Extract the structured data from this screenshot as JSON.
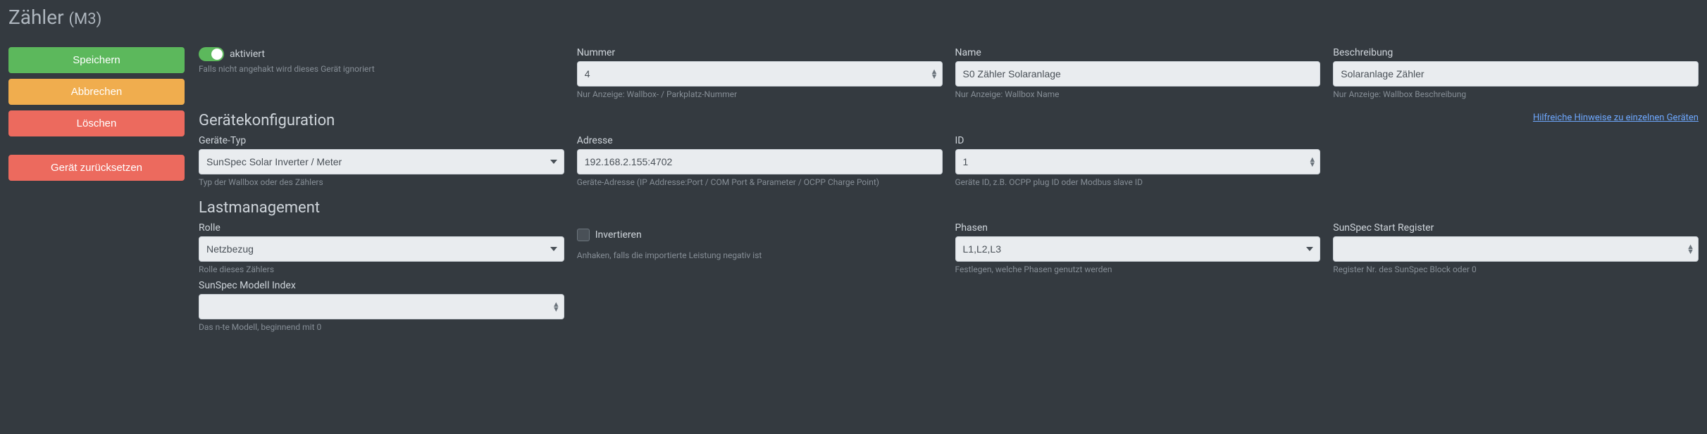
{
  "header": {
    "title_main": "Zähler",
    "title_sub": "(M3)"
  },
  "sidebar": {
    "save": "Speichern",
    "cancel": "Abbrechen",
    "delete": "Löschen",
    "reset": "Gerät zurücksetzen"
  },
  "activated": {
    "label": "aktiviert",
    "help": "Falls nicht angehakt wird dieses Gerät ignoriert",
    "checked": true
  },
  "nummer": {
    "label": "Nummer",
    "value": "4",
    "help": "Nur Anzeige: Wallbox- / Parkplatz-Nummer"
  },
  "name": {
    "label": "Name",
    "value": "S0 Zähler Solaranlage",
    "help": "Nur Anzeige: Wallbox Name"
  },
  "beschreibung": {
    "label": "Beschreibung",
    "value": "Solaranlage Zähler",
    "help": "Nur Anzeige: Wallbox Beschreibung"
  },
  "sections": {
    "config": "Gerätekonfiguration",
    "config_link": "Hilfreiche Hinweise zu einzelnen Geräten",
    "load": "Lastmanagement"
  },
  "geraete_typ": {
    "label": "Geräte-Typ",
    "value": "SunSpec Solar Inverter / Meter",
    "help": "Typ der Wallbox oder des Zählers"
  },
  "adresse": {
    "label": "Adresse",
    "value": "192.168.2.155:4702",
    "help": "Geräte-Adresse (IP Addresse:Port / COM Port & Parameter / OCPP Charge Point)"
  },
  "id": {
    "label": "ID",
    "value": "1",
    "help": "Geräte ID, z.B. OCPP plug ID oder Modbus slave ID"
  },
  "rolle": {
    "label": "Rolle",
    "value": "Netzbezug",
    "help": "Rolle dieses Zählers"
  },
  "invertieren": {
    "label": "Invertieren",
    "help": "Anhaken, falls die importierte Leistung negativ ist"
  },
  "phasen": {
    "label": "Phasen",
    "value": "L1,L2,L3",
    "help": "Festlegen, welche Phasen genutzt werden"
  },
  "sunspec_start": {
    "label": "SunSpec Start Register",
    "value": "",
    "help": "Register Nr. des SunSpec Block oder 0"
  },
  "sunspec_index": {
    "label": "SunSpec Modell Index",
    "value": "",
    "help": "Das n-te Modell, beginnend mit 0"
  }
}
